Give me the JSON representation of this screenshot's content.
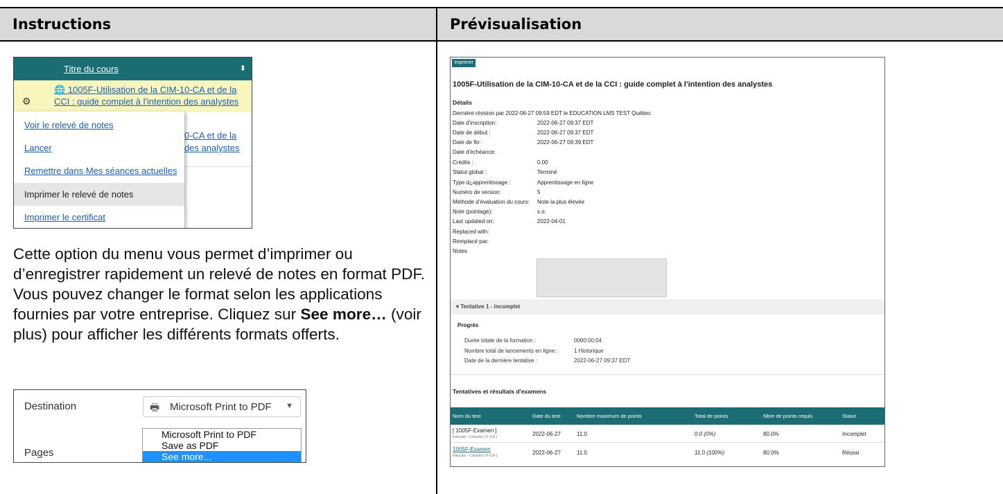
{
  "headers": {
    "left": "Instructions",
    "right": "Prévisualisation"
  },
  "shot1": {
    "col_header": "Titre du cours",
    "sort_icon": "sort-icon",
    "course_link": "1005F-Utilisation de la CIM-10-CA et de la CCI : guide complet à l'intention des analystes",
    "course_link_line1": "1005F-Utilisation de la CIM-10-CA et de la",
    "course_link_line2": "CCI : guide complet à l'intention des analystes",
    "bg_line1": "0-CA et de la",
    "bg_line2": "des analystes",
    "menu": [
      "Voir le relevé de notes",
      "Lancer",
      "Remettre dans Mes séances actuelles",
      "Imprimer le relevé de notes",
      "Imprimer le certificat"
    ]
  },
  "description": {
    "part1": "Cette option du menu vous permet d’imprimer ou d’enregistrer rapidement un relevé de notes en format PDF. Vous pouvez changer le format selon les applications fournies par votre entreprise. Cliquez sur ",
    "bold": "See more…",
    "part2": " (voir plus) pour afficher les différents formats offerts."
  },
  "shot2": {
    "destination_label": "Destination",
    "pages_label": "Pages",
    "selected": "Microsoft Print to PDF",
    "options": [
      "Microsoft Print to PDF",
      "Save as PDF",
      "See more..."
    ]
  },
  "preview": {
    "print_button": "Imprimer",
    "title": "1005F-Utilisation de la CIM-10-CA et de la CCI : guide complet à l'intention des analystes",
    "details_heading": "Détails",
    "revision": "Dernière révision par 2022-06-27 09:59 EDT le EDUCATION LMS TEST Québec",
    "details": [
      {
        "label": "Date d'inscription:",
        "value": "2022-06-27 09:37 EDT"
      },
      {
        "label": "Date de début :",
        "value": "2022-06-27 09:37 EDT"
      },
      {
        "label": "Date de fin :",
        "value": "2022-06-27 09:39 EDT"
      },
      {
        "label": "Date d'échéance:",
        "value": ""
      },
      {
        "label": "Crédits :",
        "value": "0.00"
      },
      {
        "label": "Statut global :",
        "value": "Terminé"
      },
      {
        "label": "Type d¿apprentissage :",
        "value": "Apprentissage en ligne"
      },
      {
        "label": "Numéro de version:",
        "value": "5"
      },
      {
        "label": "Méthode d'évaluation du cours:",
        "value": "Note la plus élevée"
      },
      {
        "label": "Note (pointage):",
        "value": "s.o."
      },
      {
        "label": "Last updated on:",
        "value": "2022-04-01"
      },
      {
        "label": "Replaced with:",
        "value": ""
      },
      {
        "label": "Remplacé par:",
        "value": ""
      },
      {
        "label": "Notes",
        "value": ""
      }
    ],
    "attempt": "Tentative 1 - incomplet",
    "progress_heading": "Progrès",
    "progress": [
      {
        "label": "Durée totale de la formation :",
        "value": "0000:00:04"
      },
      {
        "label": "Nombre total de lancements en ligne :",
        "value": "1  Historique"
      },
      {
        "label": "Date de la dernière tentative :",
        "value": "2022-06-27 09:37 EDT"
      }
    ],
    "tests_heading": "Tentatives et résultats d'examens",
    "columns": [
      "Nom du test",
      "Date du test",
      "Nombre maximum de points",
      "Total de points",
      "Nbre de points requis",
      "Statut"
    ],
    "rows": [
      {
        "name": "[ 1005F-Examen ]",
        "lang": "français - Canada ( fr-CA )",
        "date": "2022-06-27",
        "max": "11.0",
        "total": "0.0 (0%)",
        "required": "80.0%",
        "status": "Incomplet"
      },
      {
        "name": "1005F-Examen",
        "lang": "français - Canada ( fr-CA )",
        "date": "2022-06-27",
        "max": "11.0",
        "total": "11.0 (100%)",
        "required": "80.0%",
        "status": "Réussi"
      }
    ]
  }
}
